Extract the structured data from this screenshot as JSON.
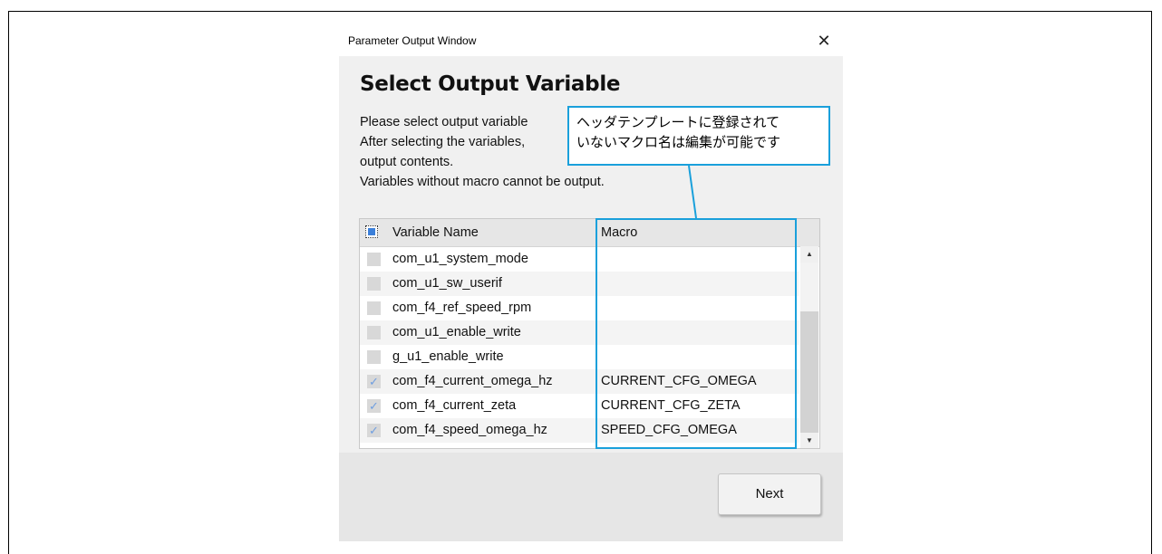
{
  "window": {
    "title": "Parameter Output Window",
    "close_glyph": "✕"
  },
  "main": {
    "heading": "Select Output Variable",
    "description": [
      "Please select output variable",
      "After selecting the variables,",
      "output contents.",
      "Variables without macro cannot be output."
    ]
  },
  "callout": {
    "lines": [
      "ヘッダテンプレートに登録されて",
      "いないマクロ名は編集が可能です"
    ],
    "color": "#1aa0db"
  },
  "table": {
    "headers": {
      "variable": "Variable Name",
      "macro": "Macro"
    },
    "rows": [
      {
        "checked": false,
        "variable": "com_u1_system_mode",
        "macro": ""
      },
      {
        "checked": false,
        "variable": "com_u1_sw_userif",
        "macro": ""
      },
      {
        "checked": false,
        "variable": "com_f4_ref_speed_rpm",
        "macro": ""
      },
      {
        "checked": false,
        "variable": "com_u1_enable_write",
        "macro": ""
      },
      {
        "checked": false,
        "variable": "g_u1_enable_write",
        "macro": ""
      },
      {
        "checked": true,
        "variable": "com_f4_current_omega_hz",
        "macro": "CURRENT_CFG_OMEGA"
      },
      {
        "checked": true,
        "variable": "com_f4_current_zeta",
        "macro": "CURRENT_CFG_ZETA"
      },
      {
        "checked": true,
        "variable": "com_f4_speed_omega_hz",
        "macro": "SPEED_CFG_OMEGA"
      }
    ],
    "check_glyph": "✓"
  },
  "footer": {
    "next_label": "Next"
  }
}
